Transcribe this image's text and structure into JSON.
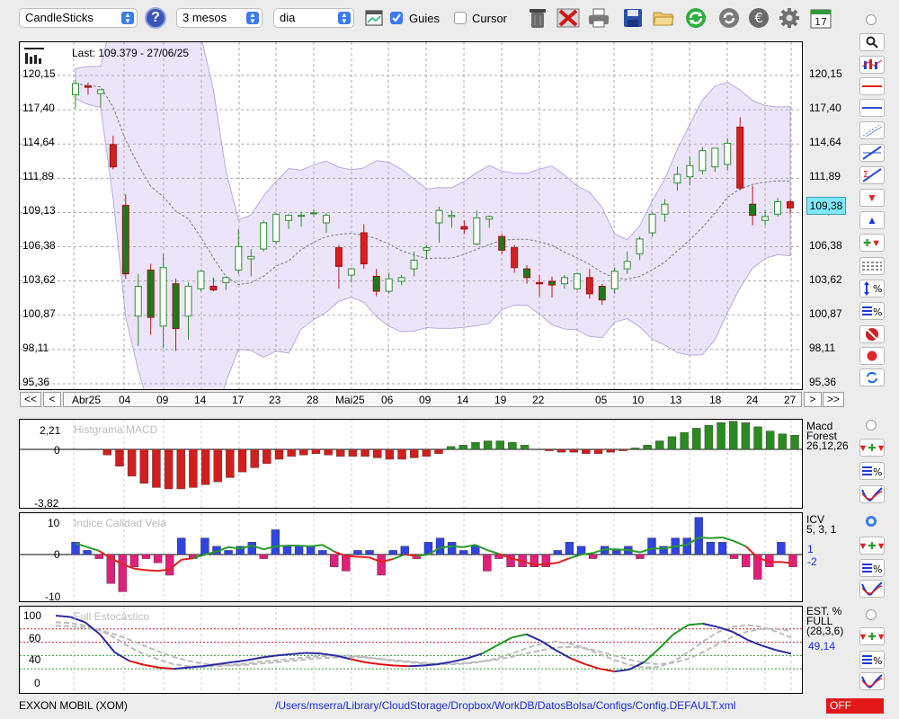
{
  "toolbar": {
    "chart_type": "CandleSticks",
    "period": "3 mesos",
    "interval": "dia",
    "guides_label": "Guies",
    "guides_checked": true,
    "cursor_label": "Cursor",
    "cursor_checked": false,
    "help_label": "?",
    "calendar_day": "17"
  },
  "main": {
    "last_label": "Last: 109.379 - 27/06/25",
    "price_badge": "109,38",
    "y_labels": [
      "120,15",
      "117,40",
      "114,64",
      "111,89",
      "109,13",
      "106,38",
      "103,62",
      "100,87",
      "98,11",
      "95,36"
    ],
    "nav": {
      "first": "<<",
      "prev": "<",
      "next": ">",
      "last": ">>"
    },
    "date_labels": [
      "Abr25",
      "04",
      "09",
      "14",
      "17",
      "23",
      "28",
      "Mai25",
      "06",
      "09",
      "14",
      "19",
      "22",
      "05",
      "10",
      "13",
      "18",
      "24",
      "27"
    ]
  },
  "macd": {
    "title": "Histgrama MACD",
    "y_top": "2,21",
    "y_zero": "0",
    "y_bottom": "-3,82",
    "side_title": "Macd",
    "side_sub": "Forest",
    "side_params": "26,12,26"
  },
  "icv": {
    "title": "Indice Calidad Vela",
    "y_top": "10",
    "y_zero": "0",
    "y_bottom": "-10",
    "side_title": "ICV",
    "side_params": "5, 3, 1",
    "val1": "1",
    "val2": "-2"
  },
  "stoch": {
    "title": "Full Estocástico",
    "y_100": "100",
    "y_60": "60",
    "y_40": "40",
    "y_0": "0",
    "side_title": "EST. %",
    "side_sub": "FULL",
    "side_params": "(28,3,6)",
    "value": "49,14"
  },
  "status": {
    "ticker": "EXXON MOBIL (XOM)",
    "path": "/Users/mserra/Library/CloudStorage/Dropbox/WorkDB/DatosBolsa/Configs/Config.DEFAULT.xml",
    "toggle": "OFF"
  },
  "colors": {
    "up": "#2e8b2e",
    "down": "#d42020",
    "band_fill": "#e6dcf8",
    "band_line": "#b8a8e0",
    "highlight": "#7fe8f8"
  },
  "chart_data": [
    {
      "type": "candlestick",
      "ylim": [
        95.36,
        120.15
      ],
      "candles": [
        {
          "o": 118.6,
          "h": 119.8,
          "l": 117.5,
          "c": 119.5
        },
        {
          "o": 119.3,
          "h": 119.6,
          "l": 118.6,
          "c": 119.2
        },
        {
          "o": 118.7,
          "h": 119.0,
          "l": 117.6,
          "c": 119.0
        },
        {
          "o": 114.6,
          "h": 115.3,
          "l": 112.6,
          "c": 112.8
        },
        {
          "o": 109.7,
          "h": 110.6,
          "l": 103.8,
          "c": 104.2
        },
        {
          "o": 100.8,
          "h": 104.2,
          "l": 98.4,
          "c": 103.2
        },
        {
          "o": 104.5,
          "h": 105.0,
          "l": 99.3,
          "c": 100.7
        },
        {
          "o": 100.0,
          "h": 105.8,
          "l": 98.2,
          "c": 104.7
        },
        {
          "o": 103.4,
          "h": 103.8,
          "l": 98.0,
          "c": 99.8
        },
        {
          "o": 100.8,
          "h": 103.5,
          "l": 98.9,
          "c": 103.2
        },
        {
          "o": 103.0,
          "h": 104.5,
          "l": 102.8,
          "c": 104.4
        },
        {
          "o": 103.2,
          "h": 103.9,
          "l": 102.8,
          "c": 102.9
        },
        {
          "o": 103.5,
          "h": 104.0,
          "l": 102.9,
          "c": 103.9
        },
        {
          "o": 104.5,
          "h": 107.8,
          "l": 104.2,
          "c": 106.4
        },
        {
          "o": 105.4,
          "h": 106.2,
          "l": 104.0,
          "c": 105.6
        },
        {
          "o": 106.2,
          "h": 108.5,
          "l": 106.0,
          "c": 108.3
        },
        {
          "o": 106.8,
          "h": 109.1,
          "l": 106.6,
          "c": 109.0
        },
        {
          "o": 108.5,
          "h": 109.0,
          "l": 107.8,
          "c": 108.9
        },
        {
          "o": 108.9,
          "h": 109.2,
          "l": 108.0,
          "c": 108.9
        },
        {
          "o": 109.1,
          "h": 109.4,
          "l": 108.8,
          "c": 109.1
        },
        {
          "o": 108.3,
          "h": 109.1,
          "l": 107.5,
          "c": 108.9
        },
        {
          "o": 106.3,
          "h": 106.5,
          "l": 103.0,
          "c": 104.8
        },
        {
          "o": 104.1,
          "h": 104.7,
          "l": 103.5,
          "c": 104.6
        },
        {
          "o": 107.5,
          "h": 108.2,
          "l": 104.6,
          "c": 105.0
        },
        {
          "o": 104.0,
          "h": 104.6,
          "l": 102.4,
          "c": 102.8
        },
        {
          "o": 102.8,
          "h": 104.3,
          "l": 102.6,
          "c": 103.8
        },
        {
          "o": 103.6,
          "h": 104.1,
          "l": 103.3,
          "c": 103.9
        },
        {
          "o": 104.6,
          "h": 106.0,
          "l": 104.0,
          "c": 105.3
        },
        {
          "o": 106.1,
          "h": 106.5,
          "l": 105.4,
          "c": 106.3
        },
        {
          "o": 108.3,
          "h": 109.6,
          "l": 106.7,
          "c": 109.3
        },
        {
          "o": 108.8,
          "h": 109.3,
          "l": 107.9,
          "c": 108.9
        },
        {
          "o": 108.0,
          "h": 108.5,
          "l": 107.4,
          "c": 107.8
        },
        {
          "o": 106.6,
          "h": 109.3,
          "l": 106.5,
          "c": 108.7
        },
        {
          "o": 108.6,
          "h": 108.9,
          "l": 107.9,
          "c": 108.8
        },
        {
          "o": 107.2,
          "h": 107.4,
          "l": 105.8,
          "c": 106.1
        },
        {
          "o": 106.3,
          "h": 106.5,
          "l": 104.3,
          "c": 104.7
        },
        {
          "o": 104.6,
          "h": 104.9,
          "l": 103.4,
          "c": 103.9
        },
        {
          "o": 103.5,
          "h": 104.1,
          "l": 102.4,
          "c": 103.4
        },
        {
          "o": 103.6,
          "h": 104.0,
          "l": 102.3,
          "c": 103.3
        },
        {
          "o": 103.4,
          "h": 104.1,
          "l": 103.0,
          "c": 103.9
        },
        {
          "o": 103.0,
          "h": 104.3,
          "l": 102.9,
          "c": 104.2
        },
        {
          "o": 103.9,
          "h": 104.6,
          "l": 102.2,
          "c": 102.6
        },
        {
          "o": 103.2,
          "h": 103.4,
          "l": 101.7,
          "c": 102.1
        },
        {
          "o": 103.0,
          "h": 104.7,
          "l": 102.6,
          "c": 104.4
        },
        {
          "o": 104.6,
          "h": 106.0,
          "l": 104.2,
          "c": 105.2
        },
        {
          "o": 105.8,
          "h": 107.2,
          "l": 105.3,
          "c": 107.0
        },
        {
          "o": 107.5,
          "h": 109.1,
          "l": 107.2,
          "c": 109.0
        },
        {
          "o": 109.0,
          "h": 110.2,
          "l": 108.4,
          "c": 109.8
        },
        {
          "o": 111.5,
          "h": 112.8,
          "l": 110.9,
          "c": 112.2
        },
        {
          "o": 112.0,
          "h": 113.6,
          "l": 111.3,
          "c": 112.9
        },
        {
          "o": 112.5,
          "h": 114.4,
          "l": 112.2,
          "c": 114.1
        },
        {
          "o": 112.8,
          "h": 114.2,
          "l": 112.4,
          "c": 114.3
        },
        {
          "o": 113.0,
          "h": 115.1,
          "l": 112.5,
          "c": 114.7
        },
        {
          "o": 116.0,
          "h": 116.8,
          "l": 110.9,
          "c": 111.1
        },
        {
          "o": 109.8,
          "h": 111.3,
          "l": 108.1,
          "c": 108.9
        },
        {
          "o": 108.5,
          "h": 109.3,
          "l": 108.1,
          "c": 108.8
        },
        {
          "o": 109.0,
          "h": 110.3,
          "l": 108.8,
          "c": 110.0
        },
        {
          "o": 110.0,
          "h": 110.1,
          "l": 109.0,
          "c": 109.5
        }
      ]
    },
    {
      "type": "bar",
      "title": "Histgrama MACD",
      "ylim": [
        -3.82,
        2.21
      ],
      "values": [
        0,
        0,
        -0.4,
        -1.2,
        -1.9,
        -2.4,
        -2.7,
        -2.8,
        -2.8,
        -2.7,
        -2.5,
        -2.3,
        -2.0,
        -1.6,
        -1.3,
        -1.0,
        -0.7,
        -0.5,
        -0.4,
        -0.3,
        -0.4,
        -0.5,
        -0.5,
        -0.5,
        -0.6,
        -0.7,
        -0.7,
        -0.6,
        -0.5,
        -0.3,
        0.2,
        0.3,
        0.5,
        0.6,
        0.6,
        0.5,
        0.3,
        0,
        -0.1,
        -0.2,
        -0.2,
        -0.3,
        -0.3,
        -0.2,
        -0.1,
        0.1,
        0.3,
        0.6,
        0.9,
        1.2,
        1.5,
        1.7,
        1.9,
        2.0,
        1.9,
        1.6,
        1.3,
        1.1,
        1.0
      ]
    },
    {
      "type": "bar",
      "title": "Indice Calidad Vela",
      "ylim": [
        -10,
        10
      ],
      "values": [
        3,
        1,
        -1,
        -7,
        -9,
        -3,
        -1,
        -2,
        -5,
        4,
        -1,
        4,
        2,
        1,
        2,
        3,
        -1,
        6,
        2,
        2,
        2,
        1,
        -3,
        -4,
        1,
        1,
        -5,
        1,
        2,
        -1,
        3,
        4,
        3,
        1,
        2,
        -4,
        -1,
        -3,
        -3,
        -3,
        -3,
        1,
        3,
        2,
        -1,
        2,
        1,
        2,
        -1,
        4,
        2,
        4,
        4,
        9,
        3,
        3,
        -1,
        -3,
        -6,
        -3,
        3,
        -3
      ]
    },
    {
      "type": "line",
      "title": "Full Estocástico",
      "ylim": [
        0,
        100
      ],
      "series": [
        {
          "values": [
            100,
            98,
            90,
            72,
            45,
            32,
            26,
            22,
            20,
            22,
            24,
            27,
            30,
            33,
            37,
            40,
            42,
            44,
            43,
            40,
            35,
            30,
            27,
            25,
            24,
            25,
            27,
            31,
            36,
            43,
            55,
            67,
            72,
            62,
            48,
            36,
            27,
            20,
            16,
            19,
            30,
            50,
            72,
            86,
            88,
            83,
            76,
            64,
            55,
            48,
            43
          ]
        },
        {
          "values": [
            90,
            89,
            85,
            78,
            67,
            53,
            42,
            34,
            27,
            24,
            23,
            24,
            26,
            28,
            31,
            33,
            35,
            37,
            39,
            40,
            40,
            38,
            35,
            32,
            30,
            28,
            27,
            27,
            28,
            31,
            36,
            43,
            51,
            58,
            61,
            58,
            51,
            42,
            33,
            26,
            22,
            23,
            31,
            45,
            61,
            75,
            83,
            86,
            83,
            76,
            67
          ]
        },
        {
          "values": [
            85,
            84,
            82,
            78,
            72,
            64,
            55,
            46,
            38,
            32,
            28,
            26,
            25,
            26,
            28,
            30,
            32,
            34,
            36,
            37,
            38,
            37,
            35,
            33,
            31,
            29,
            28,
            28,
            29,
            31,
            34,
            38,
            43,
            48,
            52,
            53,
            51,
            46,
            40,
            34,
            29,
            27,
            29,
            35,
            45,
            57,
            68,
            76,
            80,
            80,
            77
          ]
        }
      ],
      "levels": [
        80,
        60,
        40,
        20
      ]
    }
  ]
}
